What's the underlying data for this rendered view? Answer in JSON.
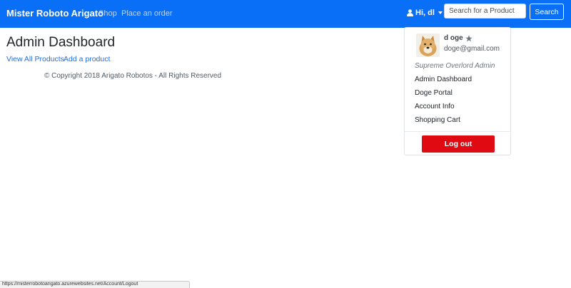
{
  "navbar": {
    "brand": "Mister Roboto Arigato",
    "links": [
      "Shop",
      "Place an order"
    ],
    "user_greeting": "Hi, dl",
    "search_placeholder": "Search for a Product",
    "search_button": "Search"
  },
  "main": {
    "title": "Admin Dashboard",
    "links": [
      "View All Products",
      "Add a product"
    ],
    "footer": "© Copyright 2018 Arigato Robotos - All Rights Reserved"
  },
  "dropdown": {
    "name": "d oge",
    "email": "doge@gmail.com",
    "role": "Supreme Overlord Admin",
    "items": [
      "Admin Dashboard",
      "Doge Portal",
      "Account Info",
      "Shopping Cart"
    ],
    "logout": "Log out"
  },
  "status_bar": {
    "url": "https://misterrobotoarigato.azurewebsites.net/Account/Logout"
  },
  "icons": {
    "user": "user-icon",
    "caret": "chevron-down-icon",
    "star": "star-icon"
  },
  "colors": {
    "navbar": "#0a6ff7",
    "link": "#1f6fe5",
    "logout": "#e00a12"
  }
}
